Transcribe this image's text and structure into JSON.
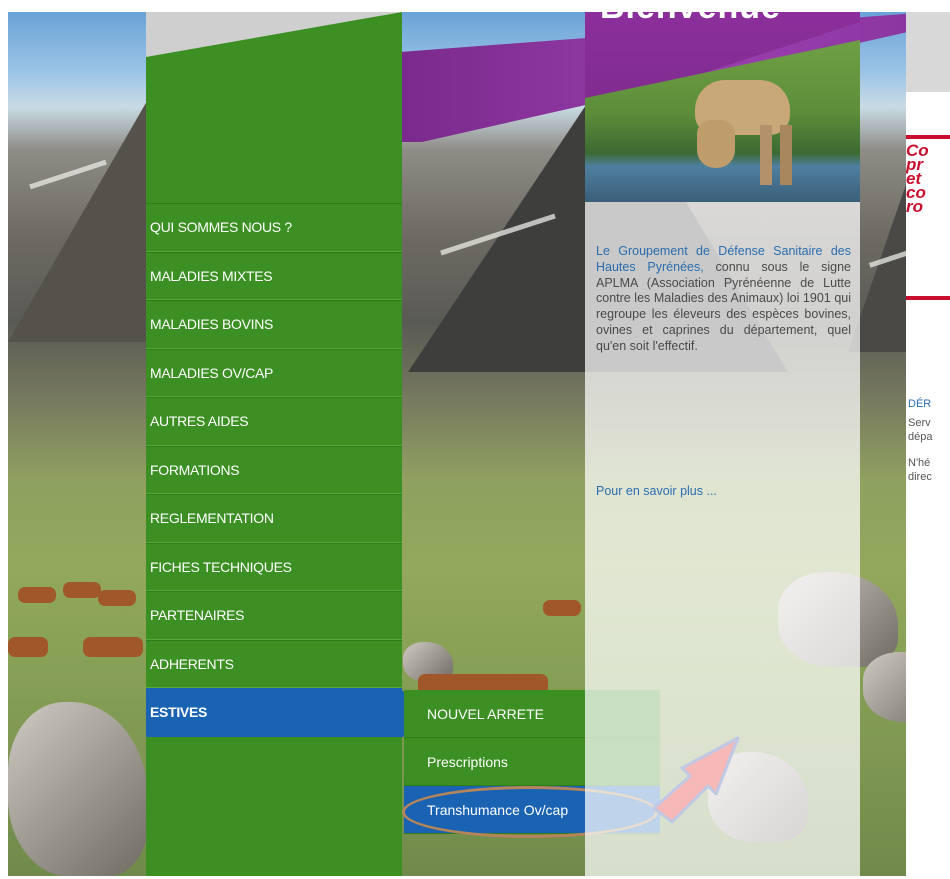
{
  "header": {
    "welcome_title": "Bienvenue"
  },
  "menu": {
    "items": [
      {
        "label": "QUI SOMMES NOUS ?"
      },
      {
        "label": "MALADIES MIXTES"
      },
      {
        "label": "MALADIES BOVINS"
      },
      {
        "label": "MALADIES OV/CAP"
      },
      {
        "label": "AUTRES AIDES"
      },
      {
        "label": "FORMATIONS"
      },
      {
        "label": "REGLEMENTATION"
      },
      {
        "label": "FICHES TECHNIQUES"
      },
      {
        "label": "PARTENAIRES"
      },
      {
        "label": "ADHERENTS"
      },
      {
        "label": "ESTIVES",
        "active": true
      }
    ]
  },
  "submenu": {
    "items": [
      {
        "label": "NOUVEL ARRETE"
      },
      {
        "label": "Prescriptions"
      },
      {
        "label": "Transhumance Ov/cap",
        "selected": true
      }
    ]
  },
  "intro": {
    "org_name": "Le Groupement de Défense Sanitaire des Hautes Pyrénées,",
    "body": " connu sous le signe APLMA (Association Pyrénéenne de Lutte contre les Maladies des Animaux) loi 1901 qui regroupe les éleveurs des espèces bovines, ovines et caprines du département, quel qu'en soit l'effectif.",
    "more_link": "Pour en savoir plus ..."
  },
  "right_panel": {
    "title_partial": "Co\npr\net\nco\nro",
    "news_heading_partial": "DÉR",
    "news_line_1_partial": "Serv\ndépa",
    "news_line_2_partial": "N'hé\ndirec"
  },
  "colors": {
    "menu_green": "#3c8f23",
    "active_blue": "#1a63b3",
    "purple_band": "#8a35a0",
    "link_blue": "#2a6db0",
    "accent_red": "#c8102e",
    "annotation_arrow": "#e00000",
    "annotation_ellipse": "#b5845a"
  }
}
